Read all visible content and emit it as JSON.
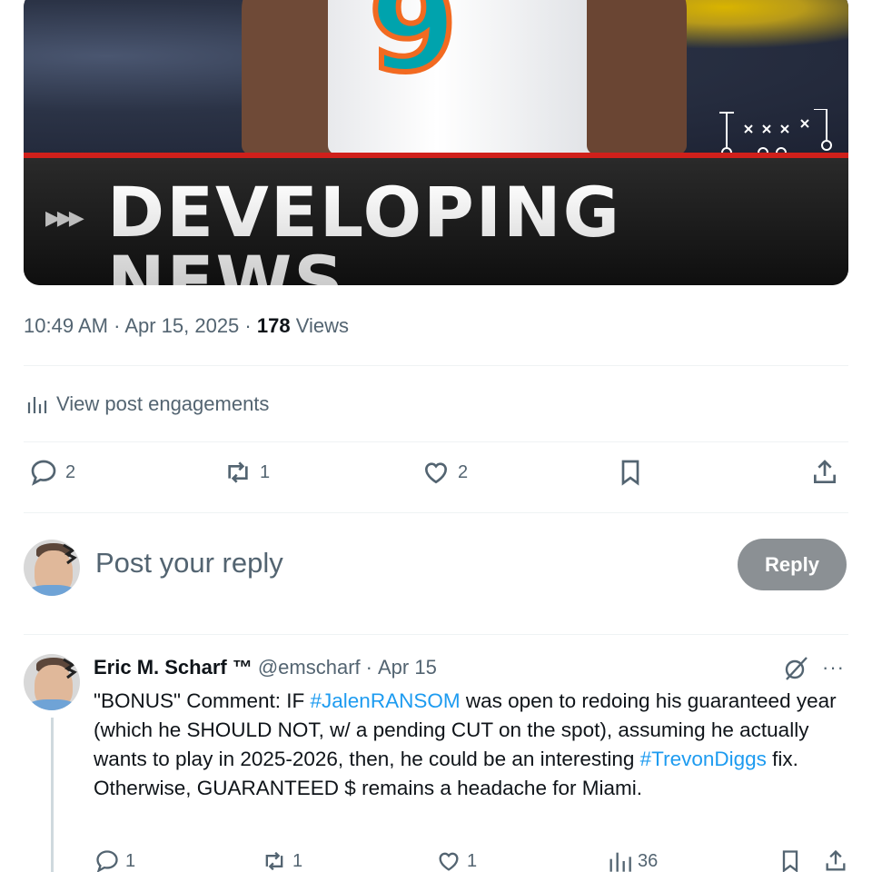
{
  "media": {
    "banner_text": "DEVELOPING NEWS",
    "arrows": "▶▶▶",
    "jersey_number": "9"
  },
  "meta": {
    "time": "10:49 AM",
    "date": "Apr 15, 2025",
    "views_count": "178",
    "views_label": "Views"
  },
  "engagements_label": "View post engagements",
  "actions": {
    "replies": "2",
    "reposts": "1",
    "likes": "2"
  },
  "composer": {
    "placeholder": "Post your reply",
    "reply_button": "Reply"
  },
  "reply_tweet": {
    "name": "Eric M. Scharf ™",
    "handle": "@emscharf",
    "separator": "·",
    "date": "Apr 15",
    "more": "···",
    "body_1": "\"BONUS\" Comment: IF ",
    "hashtag_1": "#JalenRANSOM",
    "body_2": " was open to redoing his guaranteed year (which he SHOULD NOT, w/ a pending CUT on the spot), assuming he actually wants to play in 2025-2026, then, he could be an interesting ",
    "hashtag_2": "#TrevonDiggs",
    "body_3": " fix. Otherwise, GUARANTEED $ remains a headache for Miami.",
    "replies": "1",
    "reposts": "1",
    "likes": "1",
    "views": "36"
  },
  "colors": {
    "accent": "#1d9bf0",
    "muted": "#536471",
    "banner_red": "#d0201b"
  }
}
